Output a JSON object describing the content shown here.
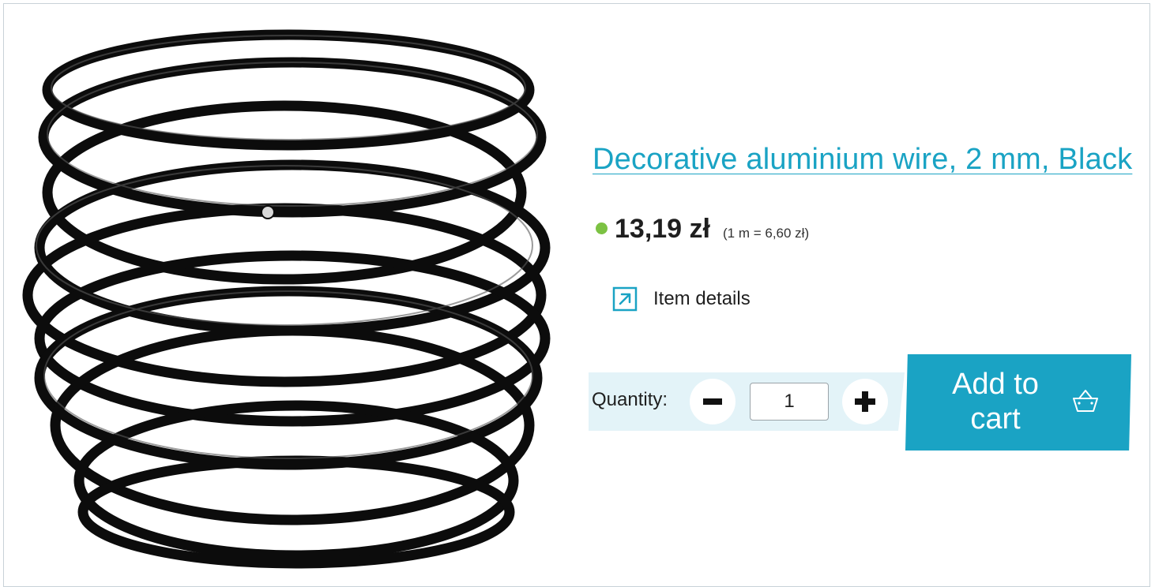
{
  "product": {
    "title": "Decorative aluminium wire, 2 mm, Black",
    "price": "13,19 zł",
    "unit_price": "(1 m = 6,60 zł)",
    "stock_status_color": "#7cc243",
    "image_icon": "black-wire-coil-image"
  },
  "details_link": {
    "label": "Item details",
    "icon": "external-arrow-icon"
  },
  "quantity": {
    "label": "Quantity:",
    "value": "1",
    "decrement_icon": "minus-icon",
    "increment_icon": "plus-icon"
  },
  "cart_button": {
    "label": "Add to cart",
    "icon": "basket-icon"
  },
  "colors": {
    "accent": "#1aa3c4",
    "quantity_band": "#e3f3f8",
    "in_stock": "#7cc243"
  }
}
